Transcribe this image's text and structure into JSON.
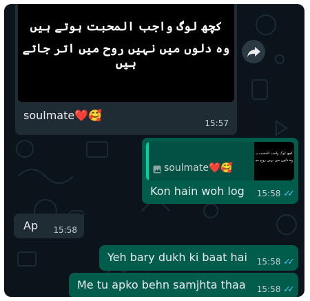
{
  "messages": [
    {
      "image_text_line1": "کچھ لوگ واجب المحبت ہوتے ہیں",
      "image_text_line2": "وہ دلوں میں نہیں روح میں اتر جاتے ہیں",
      "caption": "soulmate",
      "caption_emoji": "❤️🥰",
      "time": "15:57"
    },
    {
      "quoted_caption": "soulmate",
      "quoted_emoji": "❤️🥰",
      "text": "Kon hain woh log",
      "time": "15:58",
      "ticks": "✓✓"
    },
    {
      "text": "Ap",
      "time": "15:58"
    },
    {
      "text": "Yeh bary dukh ki baat hai",
      "time": "15:58",
      "ticks": "✓✓"
    },
    {
      "text": "Me tu apko behn samjhta thaa",
      "time": "15:58",
      "ticks": "✓✓"
    }
  ],
  "colors": {
    "chat_background": "#0b141a",
    "incoming_bubble": "#202c33",
    "outgoing_bubble": "#005c4b",
    "read_ticks": "#53bdeb"
  },
  "icons": [
    "forward-icon",
    "photo-icon"
  ]
}
